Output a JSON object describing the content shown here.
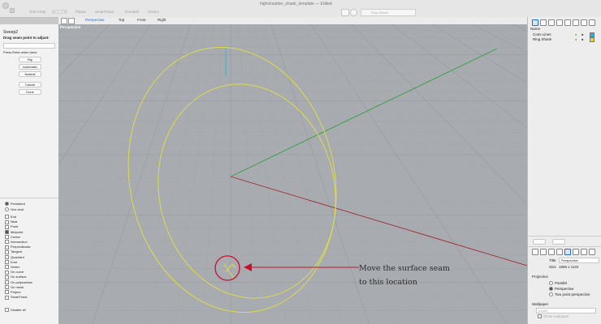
{
  "window": {
    "doc_title": "highshoulder_shank_template — Edited",
    "tabs": [
      "Grid Snap",
      "Ortho",
      "Planar",
      "SmartTrack",
      "Gumball",
      "History"
    ],
    "search_placeholder": "Ring Shank"
  },
  "view_tabs": [
    "Perspective",
    "Top",
    "Front",
    "Right"
  ],
  "viewport": {
    "label": "Perspective"
  },
  "command": {
    "name": "Sweep2",
    "prompt": "Drag seam point to adjust:",
    "input_value": "",
    "hint": "Press Enter when done",
    "buttons": [
      "Flip",
      "Automatic",
      "Natural",
      "Cancel",
      "Done"
    ]
  },
  "osnap": {
    "modes": [
      {
        "label": "Persistent",
        "checked": true
      },
      {
        "label": "One shot",
        "checked": false
      }
    ],
    "items": [
      {
        "label": "End",
        "checked": false
      },
      {
        "label": "Near",
        "checked": false
      },
      {
        "label": "Point",
        "checked": false
      },
      {
        "label": "Midpoint",
        "checked": true
      },
      {
        "label": "Center",
        "checked": false
      },
      {
        "label": "Intersection",
        "checked": false
      },
      {
        "label": "Perpendicular",
        "checked": false
      },
      {
        "label": "Tangent",
        "checked": false
      },
      {
        "label": "Quadrant",
        "checked": false
      },
      {
        "label": "Knot",
        "checked": false
      },
      {
        "label": "Vertex",
        "checked": false
      },
      {
        "label": "On curve",
        "checked": false
      },
      {
        "label": "On surface",
        "checked": false
      },
      {
        "label": "On polysurface",
        "checked": false
      },
      {
        "label": "On mesh",
        "checked": false
      },
      {
        "label": "Project",
        "checked": false
      },
      {
        "label": "SmartTrack",
        "checked": false
      }
    ],
    "disable_all": "Disable all"
  },
  "layers": {
    "header": "Name",
    "rows": [
      {
        "name": "Cons Lines",
        "color": "#2bb5c9"
      },
      {
        "name": "Ring Shank",
        "color": "#e8d23a"
      }
    ]
  },
  "properties": {
    "title_label": "Title",
    "title_value": "Perspective",
    "size_label": "Size",
    "size_value": "1586 x 1134",
    "projection_label": "Projection",
    "projection_options": [
      {
        "label": "Parallel",
        "selected": false
      },
      {
        "label": "Perspective",
        "selected": true
      },
      {
        "label": "Two point perspective",
        "selected": false
      }
    ],
    "wallpaper_label": "Wallpaper",
    "wallpaper_items": [
      "(none)",
      "Show wallpaper"
    ]
  },
  "annotation": {
    "line1": "Move the surface seam",
    "line2": "to this location",
    "color": "#c8102e"
  },
  "colors": {
    "viewport_bg": "#a8acb1",
    "curve": "#e4e03c",
    "x_axis": "#9e2b2b",
    "y_axis": "#2e9e3c",
    "z_axis": "#2bb5c9",
    "active_tab": "#1a6fd1"
  }
}
